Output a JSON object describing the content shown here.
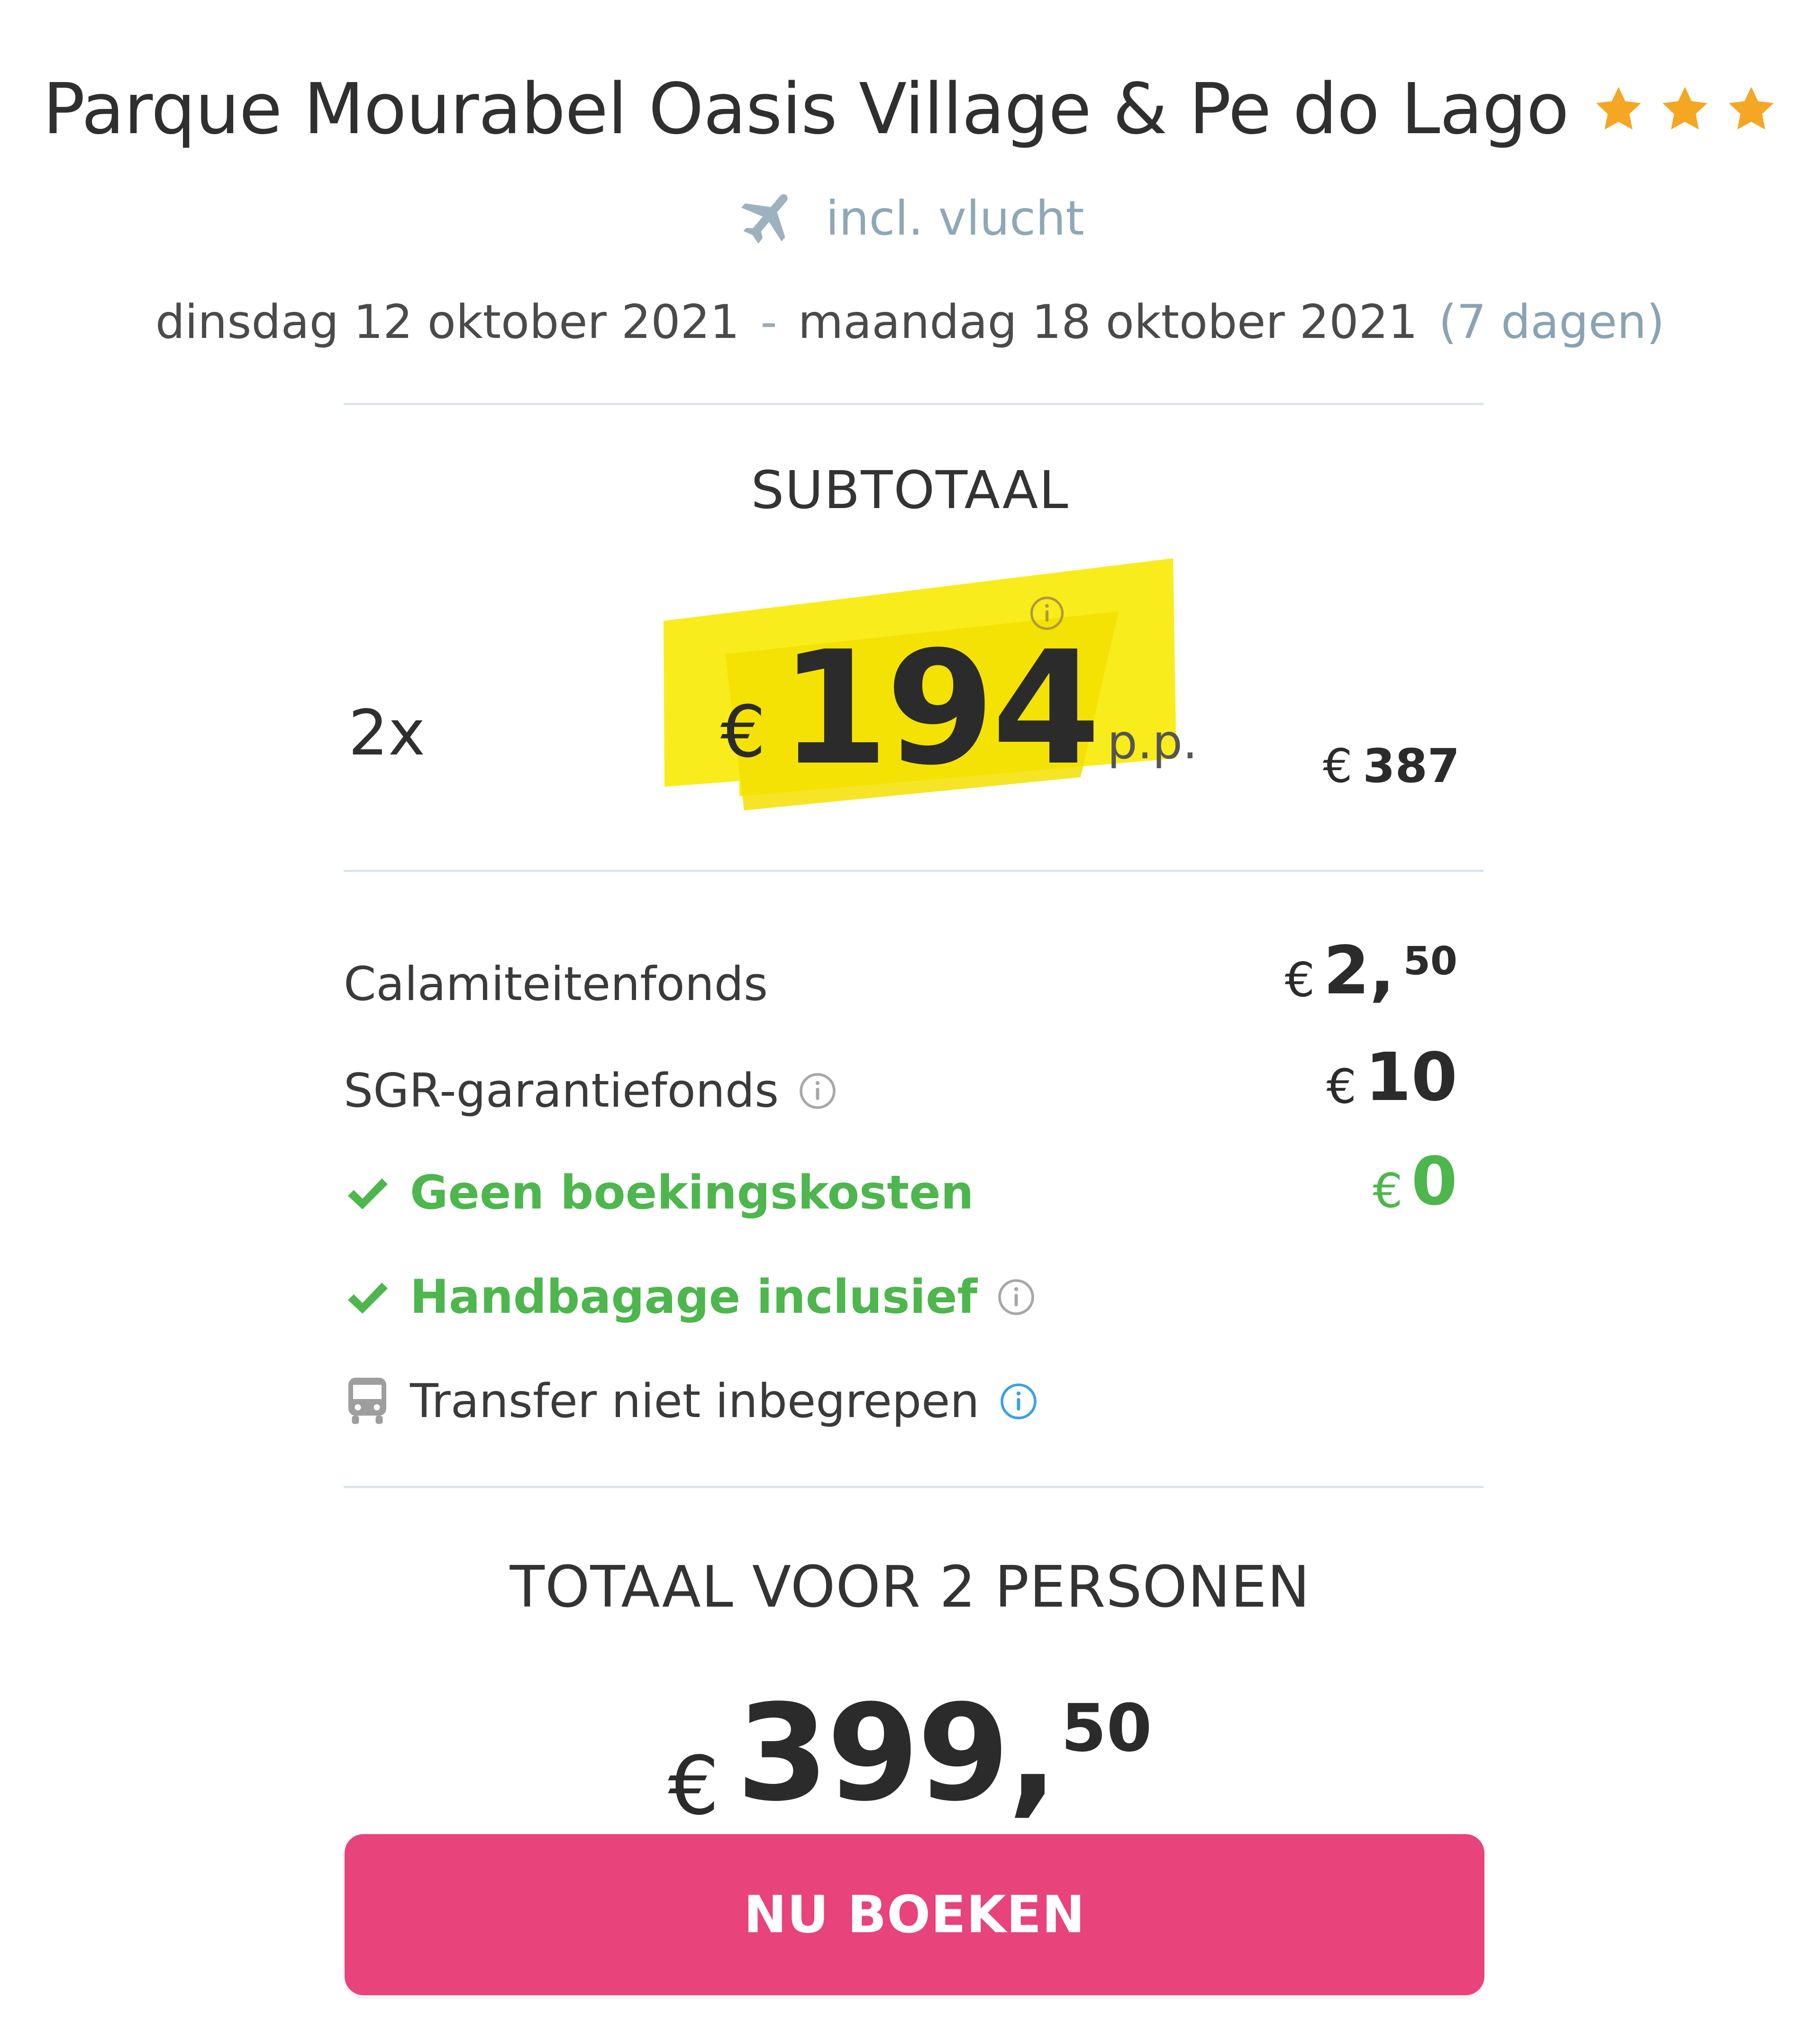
{
  "accommodation": {
    "title": "Parque Mourabel Oasis Village & Pe do Lago",
    "stars": 3,
    "star_color": "#f5a623"
  },
  "flight": {
    "icon": "airplane-icon",
    "text": "incl. vlucht"
  },
  "dates": {
    "start": "dinsdag 12 oktober 2021",
    "separator": "-",
    "end": "maandag 18 oktober 2021",
    "duration": "(7 dagen)"
  },
  "subtotal": {
    "label": "SUBTOTAAL",
    "persons": "2x",
    "currency": "€",
    "price_per_person": "194",
    "per_person_suffix": "p.p.",
    "total_currency": "€",
    "total": "387",
    "highlight_color": "#f7e400"
  },
  "costs": [
    {
      "label": "Calamiteitenfonds",
      "currency": "€",
      "amount": "2,",
      "cents": "50"
    },
    {
      "label": "SGR-garantiefonds",
      "currency": "€",
      "amount": "10",
      "info_icon": "info-icon"
    },
    {
      "label": "Geen boekingskosten",
      "currency": "€",
      "amount": "0",
      "check_icon": "check-icon"
    },
    {
      "label": "Handbagage inclusief",
      "check_icon": "check-icon",
      "info_icon": "info-icon"
    },
    {
      "label": "Transfer niet inbegrepen",
      "icon": "bus-icon",
      "info_icon": "info-icon"
    }
  ],
  "total": {
    "label": "TOTAAL VOOR 2 PERSONEN",
    "currency": "€",
    "amount": "399,",
    "cents": "50"
  },
  "cta": {
    "label": "NU BOEKEN",
    "color": "#e8437b"
  },
  "colors": {
    "green": "#4db64d",
    "divider": "#dbe6ec",
    "muted_blue": "#8aa3b4",
    "info_blue": "#3aa0e8"
  }
}
